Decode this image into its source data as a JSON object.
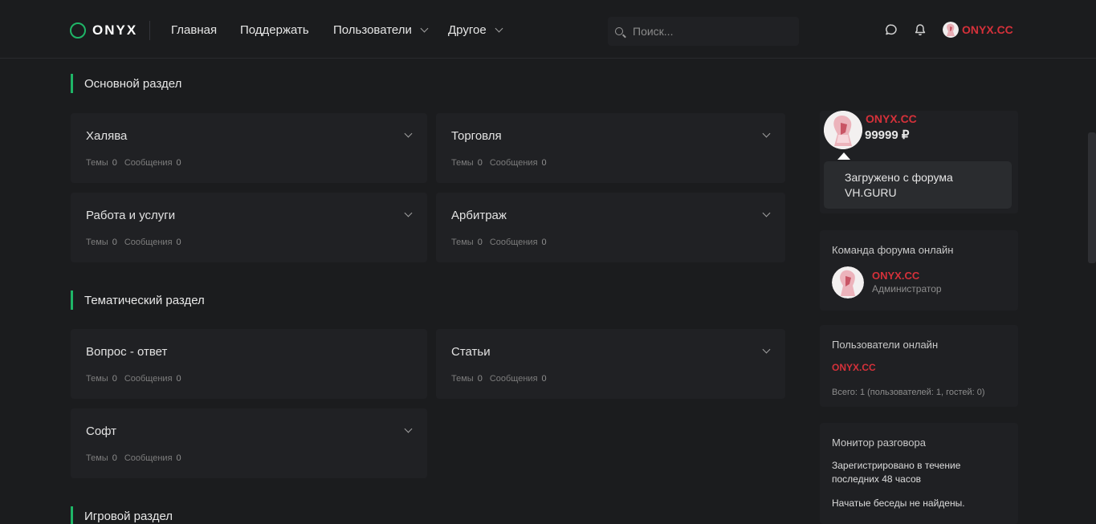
{
  "header": {
    "logo_text": "ONYX",
    "nav": [
      {
        "label": "Главная"
      },
      {
        "label": "Поддержать"
      },
      {
        "label": "Пользователи"
      },
      {
        "label": "Другое"
      }
    ],
    "search_placeholder": "Поиск...",
    "username": "ONYX.CC"
  },
  "sections": [
    {
      "title": "Основной раздел",
      "forums": [
        {
          "title": "Халява",
          "topics_label": "Темы",
          "topics": "0",
          "posts_label": "Сообщения",
          "posts": "0"
        },
        {
          "title": "Торговля",
          "topics_label": "Темы",
          "topics": "0",
          "posts_label": "Сообщения",
          "posts": "0"
        },
        {
          "title": "Работа и услуги",
          "topics_label": "Темы",
          "topics": "0",
          "posts_label": "Сообщения",
          "posts": "0"
        },
        {
          "title": "Арбитраж",
          "topics_label": "Темы",
          "topics": "0",
          "posts_label": "Сообщения",
          "posts": "0"
        }
      ]
    },
    {
      "title": "Тематический раздел",
      "forums": [
        {
          "title": "Вопрос - ответ",
          "topics_label": "Темы",
          "topics": "0",
          "posts_label": "Сообщения",
          "posts": "0"
        },
        {
          "title": "Статьи",
          "topics_label": "Темы",
          "topics": "0",
          "posts_label": "Сообщения",
          "posts": "0"
        },
        {
          "title": "Софт",
          "topics_label": "Темы",
          "topics": "0",
          "posts_label": "Сообщения",
          "posts": "0"
        }
      ]
    },
    {
      "title": "Игровой раздел",
      "forums": []
    }
  ],
  "sidebar": {
    "profile": {
      "name": "ONYX.CC",
      "balance": "99999 ₽",
      "status": "Загружено с форума VH.GURU"
    },
    "staff": {
      "title": "Команда форума онлайн",
      "name": "ONYX.CC",
      "role": "Администратор"
    },
    "online": {
      "title": "Пользователи онлайн",
      "user": "ONYX.CC",
      "summary": "Всего: 1 (пользователей: 1, гостей: 0)"
    },
    "monitor": {
      "title": "Монитор разговора",
      "registered": "Зарегистрировано в течение последних 48 часов",
      "empty": "Начатые беседы не найдены."
    }
  },
  "colors": {
    "accent": "#1fb567",
    "username": "#d5313a",
    "background": "#1b1c1e",
    "card": "#202124"
  }
}
